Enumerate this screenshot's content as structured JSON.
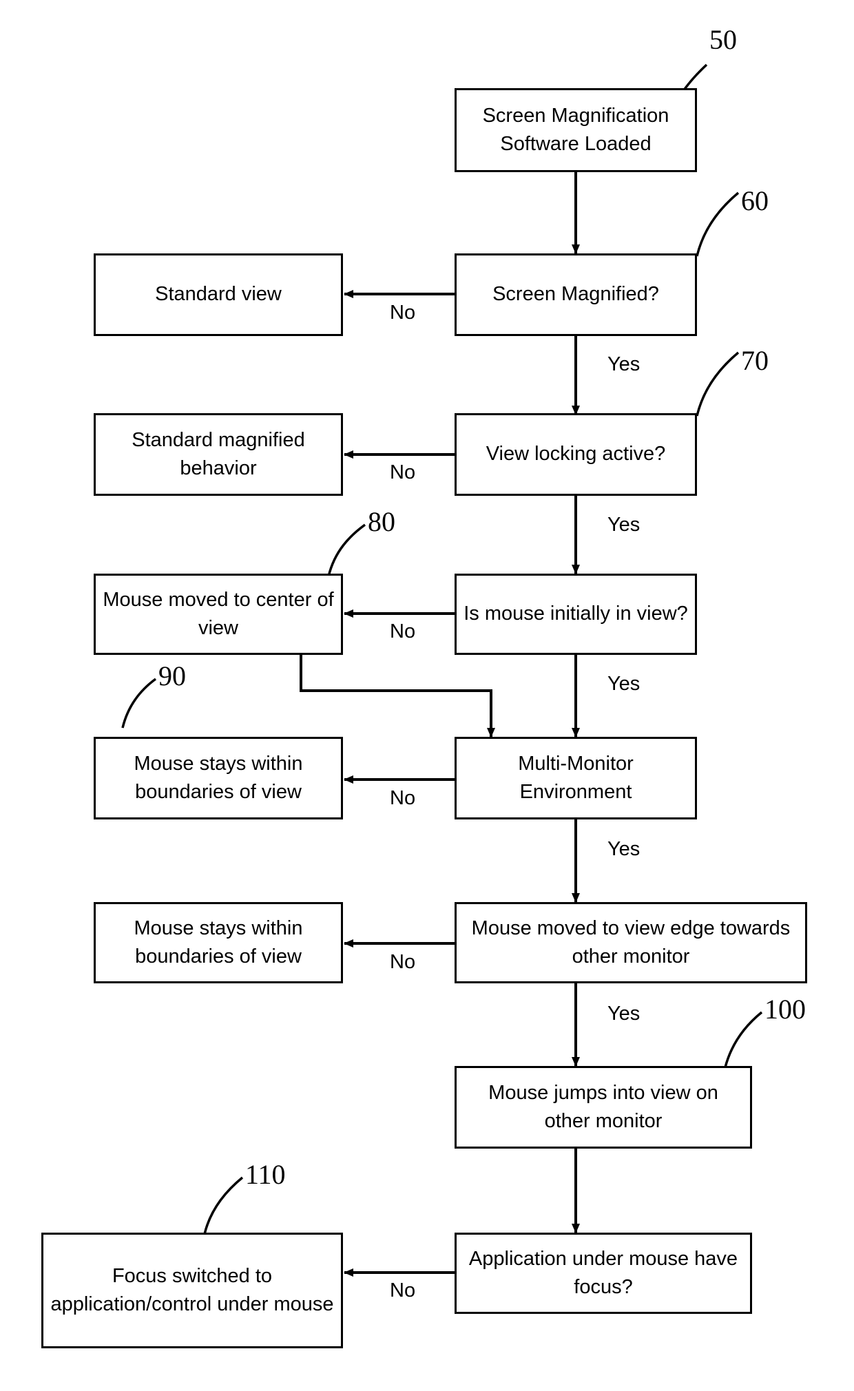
{
  "diagram": {
    "title": "Screen magnification view-locking flowchart",
    "stroke_color": "#000000",
    "background_color": "#ffffff",
    "nodes": [
      {
        "id": "n50",
        "ref": "50",
        "lines": [
          "Screen Magnification",
          "Software Loaded"
        ],
        "text": "Screen Magnification Software Loaded"
      },
      {
        "id": "n60",
        "ref": "60",
        "lines": [
          "Screen Magnified?"
        ],
        "text": "Screen Magnified?"
      },
      {
        "id": "std",
        "ref": "",
        "lines": [
          "Standard view"
        ],
        "text": "Standard view"
      },
      {
        "id": "n70",
        "ref": "70",
        "lines": [
          "View locking active?"
        ],
        "text": "View locking active?"
      },
      {
        "id": "stdm",
        "ref": "",
        "lines": [
          "Standard magnified",
          "behavior"
        ],
        "text": "Standard magnified behavior"
      },
      {
        "id": "init",
        "ref": "",
        "lines": [
          "Is mouse initially in",
          "view?"
        ],
        "text": "Is mouse initially in view?"
      },
      {
        "id": "n80",
        "ref": "80",
        "lines": [
          "Mouse moved to",
          "center of view"
        ],
        "text": "Mouse moved to center of view"
      },
      {
        "id": "mm",
        "ref": "",
        "lines": [
          "Multi-Monitor",
          "Environment"
        ],
        "text": "Multi-Monitor Environment"
      },
      {
        "id": "n90",
        "ref": "90",
        "lines": [
          "Mouse stays within",
          "boundaries of view"
        ],
        "text": "Mouse stays within boundaries of view"
      },
      {
        "id": "edge",
        "ref": "",
        "lines": [
          "Mouse moved to view edge",
          "towards other monitor"
        ],
        "text": "Mouse moved to view edge towards other monitor"
      },
      {
        "id": "stay2",
        "ref": "",
        "lines": [
          "Mouse stays within",
          "boundaries of view"
        ],
        "text": "Mouse stays within boundaries of view"
      },
      {
        "id": "n100",
        "ref": "100",
        "lines": [
          "Mouse jumps into view on",
          "other monitor"
        ],
        "text": "Mouse jumps into view on other monitor"
      },
      {
        "id": "focusq",
        "ref": "",
        "lines": [
          "Application under mouse",
          "have focus?"
        ],
        "text": "Application under mouse have focus?"
      },
      {
        "id": "n110",
        "ref": "110",
        "lines": [
          "Focus switched to",
          "application/control under",
          "mouse"
        ],
        "text": "Focus switched to application/control under mouse"
      }
    ],
    "reference_numerals": [
      "50",
      "60",
      "70",
      "80",
      "90",
      "100",
      "110"
    ],
    "edge_labels": {
      "no_1": "No",
      "yes_1": "Yes",
      "no_2": "No",
      "yes_2": "Yes",
      "no_3": "No",
      "yes_3": "Yes",
      "no_4": "No",
      "yes_4": "Yes",
      "no_5": "No",
      "yes_5": "Yes",
      "no_6": "No"
    }
  }
}
